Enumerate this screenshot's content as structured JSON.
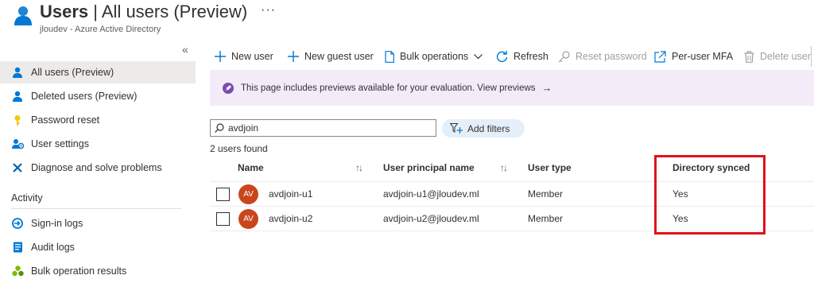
{
  "header": {
    "title_bold": "Users",
    "title_rest": " | All users (Preview)",
    "more": "···",
    "subtitle": "jloudev - Azure Active Directory"
  },
  "sidebar": {
    "collapse": "«",
    "items": [
      {
        "label": "All users (Preview)",
        "icon": "user-icon"
      },
      {
        "label": "Deleted users (Preview)",
        "icon": "user-icon"
      },
      {
        "label": "Password reset",
        "icon": "key-icon"
      },
      {
        "label": "User settings",
        "icon": "user-settings-icon"
      },
      {
        "label": "Diagnose and solve problems",
        "icon": "wrench-icon"
      }
    ],
    "section": "Activity",
    "activity_items": [
      {
        "label": "Sign-in logs",
        "icon": "sign-in-icon"
      },
      {
        "label": "Audit logs",
        "icon": "audit-log-icon"
      },
      {
        "label": "Bulk operation results",
        "icon": "bulk-results-icon"
      }
    ]
  },
  "toolbar": {
    "new_user": "New user",
    "new_guest_user": "New guest user",
    "bulk_operations": "Bulk operations",
    "refresh": "Refresh",
    "reset_password": "Reset password",
    "per_user_mfa": "Per-user MFA",
    "delete_user": "Delete user"
  },
  "banner": {
    "text": "This page includes previews available for your evaluation. View previews",
    "arrow": "→"
  },
  "search": {
    "value": "avdjoin"
  },
  "filters": {
    "label": "Add filters"
  },
  "result_count": "2 users found",
  "table": {
    "columns": {
      "name": "Name",
      "upn": "User principal name",
      "user_type": "User type",
      "directory_synced": "Directory synced"
    },
    "sort_glyph": "↑↓",
    "rows": [
      {
        "initials": "AV",
        "name": "avdjoin-u1",
        "upn": "avdjoin-u1@jloudev.ml",
        "user_type": "Member",
        "directory_synced": "Yes"
      },
      {
        "initials": "AV",
        "name": "avdjoin-u2",
        "upn": "avdjoin-u2@jloudev.ml",
        "user_type": "Member",
        "directory_synced": "Yes"
      }
    ]
  },
  "colors": {
    "accent": "#0078d4",
    "avatar": "#c9461c",
    "banner_bg": "#f3ecf8",
    "highlight": "#e0121a"
  }
}
